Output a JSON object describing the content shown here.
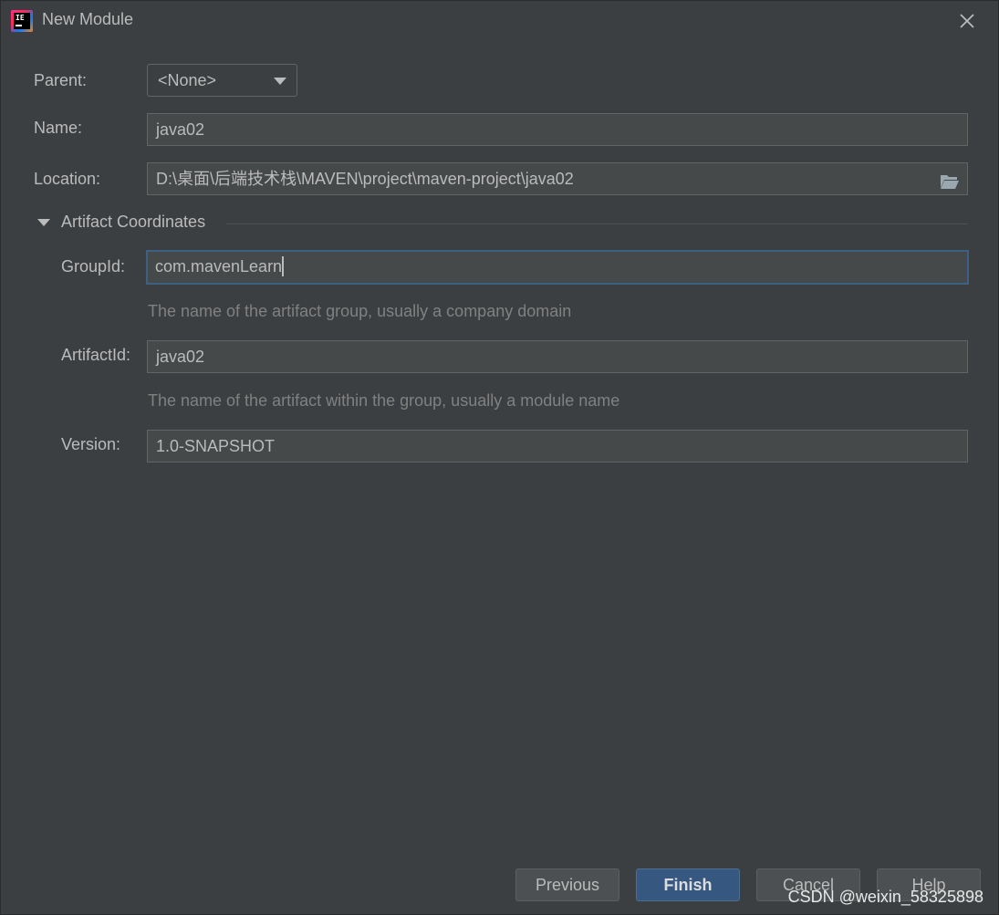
{
  "window": {
    "title": "New Module",
    "app_icon_text": "IE"
  },
  "form": {
    "parent": {
      "label": "Parent:",
      "value": "<None>"
    },
    "name": {
      "label": "Name:",
      "value": "java02"
    },
    "location": {
      "label": "Location:",
      "value": "D:\\桌面\\后端技术栈\\MAVEN\\project\\maven-project\\java02"
    },
    "artifact_section": {
      "title": "Artifact Coordinates",
      "expanded": true
    },
    "group_id": {
      "label": "GroupId:",
      "value": "com.mavenLearn",
      "hint": "The name of the artifact group, usually a company domain",
      "focused": true
    },
    "artifact_id": {
      "label": "ArtifactId:",
      "value": "java02",
      "hint": "The name of the artifact within the group, usually a module name"
    },
    "version": {
      "label": "Version:",
      "value": "1.0-SNAPSHOT"
    }
  },
  "buttons": {
    "previous": "Previous",
    "finish": "Finish",
    "cancel": "Cancel",
    "help": "Help"
  },
  "watermark": "CSDN @weixin_58325898",
  "icons": {
    "app": "intellij-idea-icon",
    "close": "close-icon",
    "dropdown": "chevron-down-icon",
    "folder": "folder-open-icon",
    "section_toggle": "triangle-down-icon"
  },
  "colors": {
    "background": "#3c3f41",
    "field_background": "#45494a",
    "field_border": "#646464",
    "focus_border": "#3d6185",
    "primary_button": "#365880",
    "text": "#bbbbbb",
    "hint_text": "#808080"
  }
}
